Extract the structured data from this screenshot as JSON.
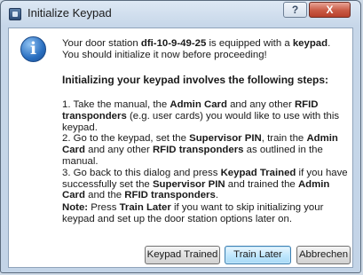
{
  "window": {
    "title": "Initialize Keypad",
    "help_label": "?",
    "close_label": "X"
  },
  "message": {
    "intro_pre": "Your door station ",
    "station_id": "dfi-10-9-49-25",
    "intro_mid": " is equipped with a ",
    "keypad_word": "keypad",
    "intro_post": ".",
    "intro_line2": "You should initialize it now before proceeding!",
    "heading": "Initializing your keypad involves the following steps:",
    "step1": {
      "a": "1. Take the manual, the ",
      "b": "Admin Card",
      "c": " and any other ",
      "d": "RFID transponders",
      "e": " (e.g. user cards) you would like to use with this keypad."
    },
    "step2": {
      "a": "2. Go to the keypad, set the ",
      "b": "Supervisor PIN",
      "c": ", train the ",
      "d": "Admin Card",
      "e": " and any other ",
      "f": "RFID transponders",
      "g": " as outlined in the manual."
    },
    "step3": {
      "a": "3. Go back to this dialog and press ",
      "b": "Keypad Trained",
      "c": " if you have successfully set the ",
      "d": "Supervisor PIN",
      "e": " and trained the ",
      "f": "Admin Card",
      "g": " and the ",
      "h": "RFID transponders",
      "i": "."
    },
    "note": {
      "label": "Note:",
      "a": " Press ",
      "b": "Train Later",
      "c": " if you want to skip initializing your keypad and set up the door station options later on."
    }
  },
  "buttons": {
    "keypad_trained": "Keypad Trained",
    "train_later": "Train Later",
    "cancel": "Abbrechen"
  }
}
